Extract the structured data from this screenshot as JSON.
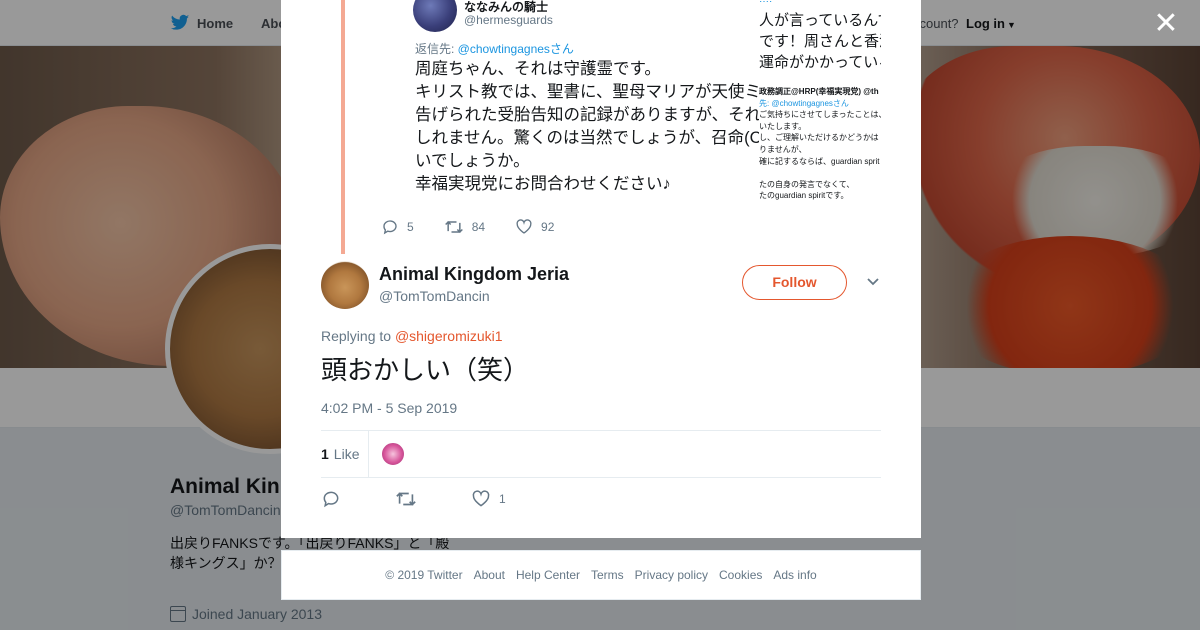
{
  "nav": {
    "home": "Home",
    "about": "Abo",
    "have_account": "ccount?",
    "login": "Log in"
  },
  "profile": {
    "name": "Animal Kin",
    "handle": "@TomTomDancin",
    "bio": "出戻りFANKSです。「出戻りFANKS」と「殿様キングス」か？似てないか。",
    "joined": "Joined January 2013"
  },
  "quoted": {
    "name": "ななみんの騎士",
    "handle": "@hermesguards",
    "reply_prefix": "返信先: ",
    "reply_to": "@chowtingagnesさん",
    "body": "周庭ちゃん、それは守護霊です。\nキリスト教では、聖書に、聖母マリアが天使ミ\n告げられた受胎告知の記録がありますが、それ\nしれません。驚くのは当然でしょうが、召命(C\nいでしょうか。\n幸福実現党にお問合わせください♪",
    "side_top": "‥‥",
    "side_big": "人が言っているんで\nです！周さんと香港\n運命がかかっている",
    "side_small_1": "政務調正@HRP(幸福実現党) @th",
    "side_small_2": "先: @chowtingagnesさん",
    "side_small_3": "ご気持ちにさせてしまったことは、\nいたします。\nし、ご理解いただけるかどうかは\nりませんが、\n確に記するならば、guardian sprit\n\nたの自身の発言でなくて、\nたのguardian spiritです。",
    "replies": "5",
    "retweets": "84",
    "likes": "92"
  },
  "tweet": {
    "author_name": "Animal Kingdom Jeria",
    "author_handle": "@TomTomDancin",
    "follow_label": "Follow",
    "replying_label": "Replying to ",
    "replying_to": "@shigeromizuki1",
    "text": "頭おかしい（笑）",
    "time": "4:02 PM - 5 Sep 2019",
    "likes_count": "1",
    "likes_label": "Like",
    "like_action_count": "1"
  },
  "footer": {
    "copyright": "© 2019 Twitter",
    "about": "About",
    "help": "Help Center",
    "terms": "Terms",
    "privacy": "Privacy policy",
    "cookies": "Cookies",
    "ads": "Ads info"
  },
  "colors": {
    "accent": "#e4572e",
    "link_blue": "#1b95e0",
    "muted": "#657786",
    "quote_bar": "#f4a993"
  },
  "icons": [
    "twitter-bird-icon",
    "caret-down-icon",
    "close-icon",
    "reply-icon",
    "retweet-icon",
    "heart-icon",
    "calendar-icon",
    "chevron-down-icon"
  ]
}
